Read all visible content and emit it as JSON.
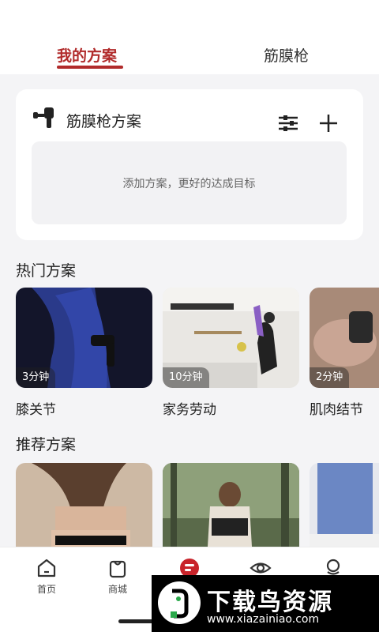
{
  "tabs": [
    {
      "label": "我的方案",
      "active": true
    },
    {
      "label": "筋膜枪",
      "active": false
    }
  ],
  "accent_color": "#b12b2b",
  "plan_card": {
    "title": "筋膜枪方案",
    "title_icon": "massage-gun-icon",
    "filter_icon": "sliders-icon",
    "add_icon": "plus-icon",
    "empty_text": "添加方案，更好的达成目标"
  },
  "hot_section": {
    "title": "热门方案",
    "items": [
      {
        "duration": "3分钟",
        "name": "膝关节"
      },
      {
        "duration": "10分钟",
        "name": "家务劳动"
      },
      {
        "duration": "2分钟",
        "name": "肌肉结节"
      }
    ]
  },
  "rec_section": {
    "title": "推荐方案"
  },
  "bottom_nav": [
    {
      "label": "首页",
      "icon": "home-icon"
    },
    {
      "label": "商城",
      "icon": "shopping-bag-icon"
    },
    {
      "label": "",
      "icon": "plan-icon"
    },
    {
      "label": "",
      "icon": "eye-icon"
    },
    {
      "label": "",
      "icon": "profile-icon"
    }
  ],
  "watermark": {
    "main": "下载鸟资源",
    "url": "www.xiazainiao.com"
  }
}
